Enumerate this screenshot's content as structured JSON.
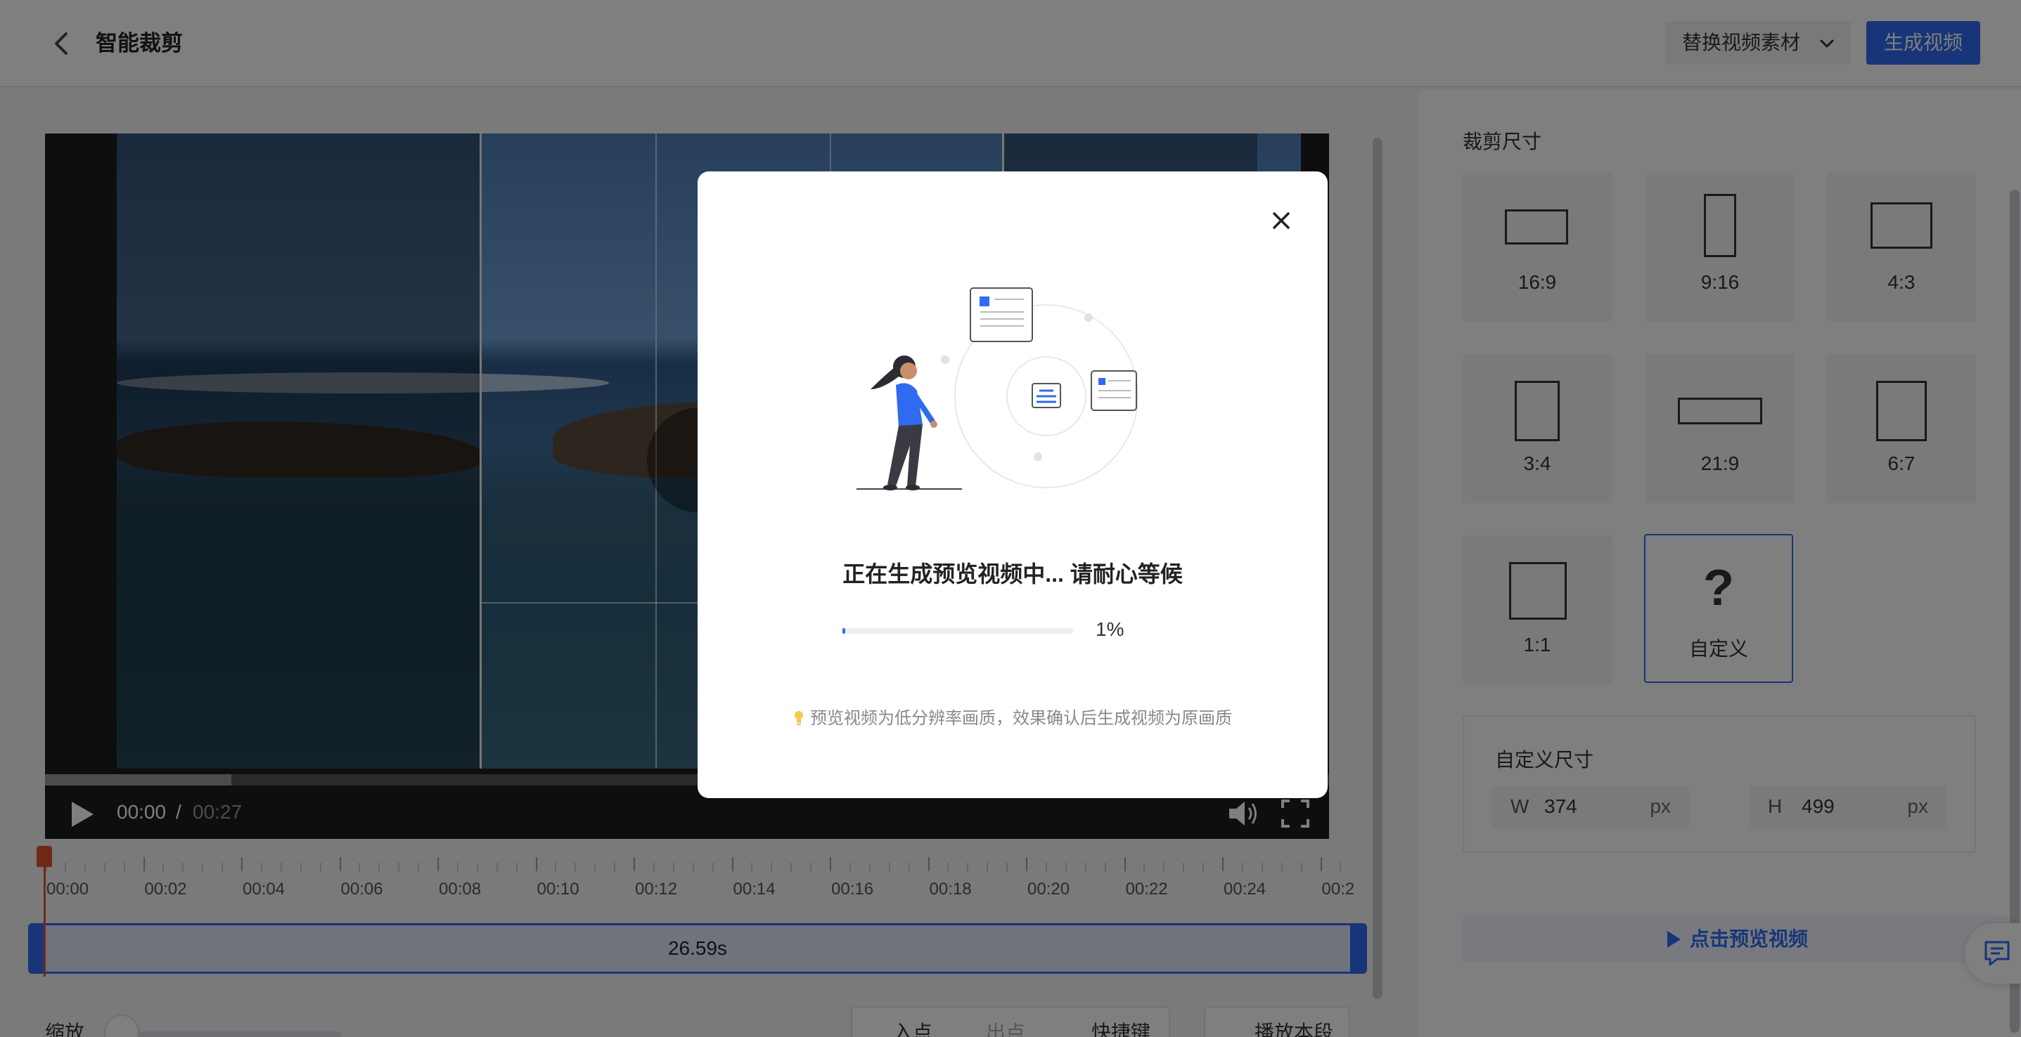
{
  "header": {
    "title": "智能裁剪",
    "replace_label": "替换视频素材",
    "generate_label": "生成视频"
  },
  "player": {
    "current_time": "00:00",
    "separator": "/",
    "total_time": "00:27",
    "buffered_fraction": 0.145
  },
  "timeline": {
    "ticks": [
      "00:00",
      "00:02",
      "00:04",
      "00:06",
      "00:08",
      "00:10",
      "00:12",
      "00:14",
      "00:16",
      "00:18",
      "00:20",
      "00:22",
      "00:24",
      "00:2"
    ],
    "segment_label": "26.59s"
  },
  "bottom_bar": {
    "zoom_label": "缩放",
    "in_point": "入点",
    "out_point": "出点",
    "shortcuts": "快捷键",
    "play_segment": "播放本段"
  },
  "crop_panel": {
    "title": "裁剪尺寸",
    "ratios": [
      {
        "label": "16:9"
      },
      {
        "label": "9:16"
      },
      {
        "label": "4:3"
      },
      {
        "label": "3:4"
      },
      {
        "label": "21:9"
      },
      {
        "label": "6:7"
      },
      {
        "label": "1:1"
      },
      {
        "label": "自定义",
        "glyph": "?"
      }
    ],
    "custom_title": "自定义尺寸",
    "width": {
      "label": "W",
      "value": "374",
      "unit": "px"
    },
    "height": {
      "label": "H",
      "value": "499",
      "unit": "px"
    },
    "preview_label": "点击预览视频"
  },
  "modal": {
    "message": "正在生成预览视频中... 请耐心等候",
    "progress_value": 0.01,
    "progress_text": "1%",
    "tip": "预览视频为低分辨率画质，效果确认后生成视频为原画质"
  },
  "colors": {
    "accent": "#2f6bf0",
    "playhead": "#e0532b"
  }
}
